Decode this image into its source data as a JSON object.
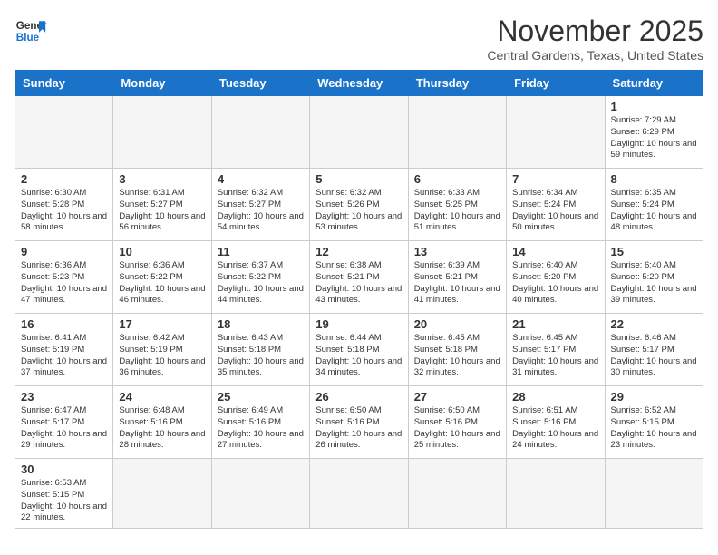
{
  "header": {
    "logo_general": "General",
    "logo_blue": "Blue",
    "month_title": "November 2025",
    "location": "Central Gardens, Texas, United States"
  },
  "weekdays": [
    "Sunday",
    "Monday",
    "Tuesday",
    "Wednesday",
    "Thursday",
    "Friday",
    "Saturday"
  ],
  "days": [
    {
      "date": "",
      "info": ""
    },
    {
      "date": "",
      "info": ""
    },
    {
      "date": "",
      "info": ""
    },
    {
      "date": "",
      "info": ""
    },
    {
      "date": "",
      "info": ""
    },
    {
      "date": "",
      "info": ""
    },
    {
      "date": "1",
      "info": "Sunrise: 7:29 AM\nSunset: 6:29 PM\nDaylight: 10 hours and 59 minutes."
    },
    {
      "date": "2",
      "info": "Sunrise: 6:30 AM\nSunset: 5:28 PM\nDaylight: 10 hours and 58 minutes."
    },
    {
      "date": "3",
      "info": "Sunrise: 6:31 AM\nSunset: 5:27 PM\nDaylight: 10 hours and 56 minutes."
    },
    {
      "date": "4",
      "info": "Sunrise: 6:32 AM\nSunset: 5:27 PM\nDaylight: 10 hours and 54 minutes."
    },
    {
      "date": "5",
      "info": "Sunrise: 6:32 AM\nSunset: 5:26 PM\nDaylight: 10 hours and 53 minutes."
    },
    {
      "date": "6",
      "info": "Sunrise: 6:33 AM\nSunset: 5:25 PM\nDaylight: 10 hours and 51 minutes."
    },
    {
      "date": "7",
      "info": "Sunrise: 6:34 AM\nSunset: 5:24 PM\nDaylight: 10 hours and 50 minutes."
    },
    {
      "date": "8",
      "info": "Sunrise: 6:35 AM\nSunset: 5:24 PM\nDaylight: 10 hours and 48 minutes."
    },
    {
      "date": "9",
      "info": "Sunrise: 6:36 AM\nSunset: 5:23 PM\nDaylight: 10 hours and 47 minutes."
    },
    {
      "date": "10",
      "info": "Sunrise: 6:36 AM\nSunset: 5:22 PM\nDaylight: 10 hours and 46 minutes."
    },
    {
      "date": "11",
      "info": "Sunrise: 6:37 AM\nSunset: 5:22 PM\nDaylight: 10 hours and 44 minutes."
    },
    {
      "date": "12",
      "info": "Sunrise: 6:38 AM\nSunset: 5:21 PM\nDaylight: 10 hours and 43 minutes."
    },
    {
      "date": "13",
      "info": "Sunrise: 6:39 AM\nSunset: 5:21 PM\nDaylight: 10 hours and 41 minutes."
    },
    {
      "date": "14",
      "info": "Sunrise: 6:40 AM\nSunset: 5:20 PM\nDaylight: 10 hours and 40 minutes."
    },
    {
      "date": "15",
      "info": "Sunrise: 6:40 AM\nSunset: 5:20 PM\nDaylight: 10 hours and 39 minutes."
    },
    {
      "date": "16",
      "info": "Sunrise: 6:41 AM\nSunset: 5:19 PM\nDaylight: 10 hours and 37 minutes."
    },
    {
      "date": "17",
      "info": "Sunrise: 6:42 AM\nSunset: 5:19 PM\nDaylight: 10 hours and 36 minutes."
    },
    {
      "date": "18",
      "info": "Sunrise: 6:43 AM\nSunset: 5:18 PM\nDaylight: 10 hours and 35 minutes."
    },
    {
      "date": "19",
      "info": "Sunrise: 6:44 AM\nSunset: 5:18 PM\nDaylight: 10 hours and 34 minutes."
    },
    {
      "date": "20",
      "info": "Sunrise: 6:45 AM\nSunset: 5:18 PM\nDaylight: 10 hours and 32 minutes."
    },
    {
      "date": "21",
      "info": "Sunrise: 6:45 AM\nSunset: 5:17 PM\nDaylight: 10 hours and 31 minutes."
    },
    {
      "date": "22",
      "info": "Sunrise: 6:46 AM\nSunset: 5:17 PM\nDaylight: 10 hours and 30 minutes."
    },
    {
      "date": "23",
      "info": "Sunrise: 6:47 AM\nSunset: 5:17 PM\nDaylight: 10 hours and 29 minutes."
    },
    {
      "date": "24",
      "info": "Sunrise: 6:48 AM\nSunset: 5:16 PM\nDaylight: 10 hours and 28 minutes."
    },
    {
      "date": "25",
      "info": "Sunrise: 6:49 AM\nSunset: 5:16 PM\nDaylight: 10 hours and 27 minutes."
    },
    {
      "date": "26",
      "info": "Sunrise: 6:50 AM\nSunset: 5:16 PM\nDaylight: 10 hours and 26 minutes."
    },
    {
      "date": "27",
      "info": "Sunrise: 6:50 AM\nSunset: 5:16 PM\nDaylight: 10 hours and 25 minutes."
    },
    {
      "date": "28",
      "info": "Sunrise: 6:51 AM\nSunset: 5:16 PM\nDaylight: 10 hours and 24 minutes."
    },
    {
      "date": "29",
      "info": "Sunrise: 6:52 AM\nSunset: 5:15 PM\nDaylight: 10 hours and 23 minutes."
    },
    {
      "date": "30",
      "info": "Sunrise: 6:53 AM\nSunset: 5:15 PM\nDaylight: 10 hours and 22 minutes."
    },
    {
      "date": "",
      "info": ""
    },
    {
      "date": "",
      "info": ""
    },
    {
      "date": "",
      "info": ""
    },
    {
      "date": "",
      "info": ""
    },
    {
      "date": "",
      "info": ""
    },
    {
      "date": "",
      "info": ""
    }
  ]
}
